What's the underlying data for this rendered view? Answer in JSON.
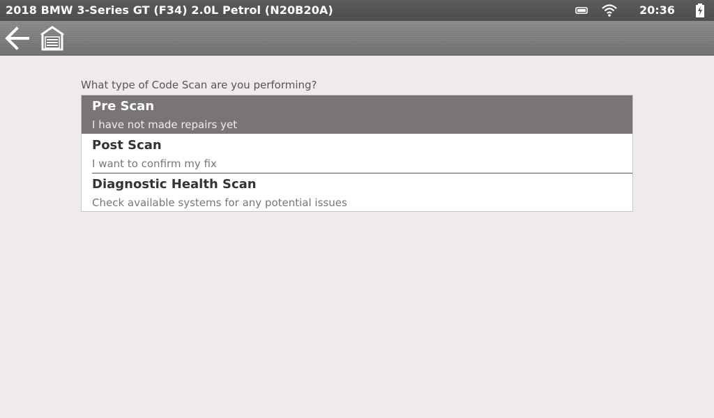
{
  "status_bar": {
    "vehicle_title": "2018 BMW 3-Series GT (F34) 2.0L Petrol (N20B20A)",
    "time": "20:36",
    "icons": [
      "sd-card-icon",
      "wifi-icon",
      "battery-charging-icon"
    ]
  },
  "toolbar": {
    "icons": [
      "back-arrow-icon",
      "garage-home-icon"
    ]
  },
  "main": {
    "question": "What type of Code Scan are you performing?",
    "selected_index": 0,
    "options": [
      {
        "title": "Pre Scan",
        "subtitle": "I have not made repairs yet"
      },
      {
        "title": "Post Scan",
        "subtitle": "I want to confirm my fix"
      },
      {
        "title": "Diagnostic Health Scan",
        "subtitle": "Check available systems for any potential issues"
      }
    ]
  },
  "colors": {
    "selected_row": "#797577",
    "background": "#efeaed",
    "status_bar": "#555555"
  }
}
